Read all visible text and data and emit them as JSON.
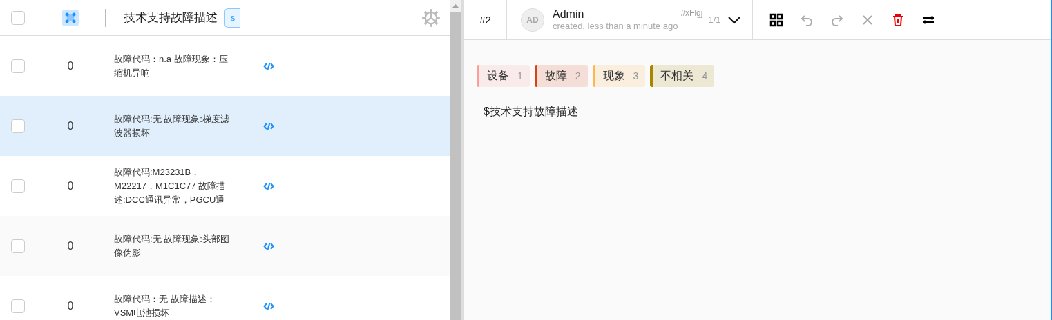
{
  "list_header": {
    "checked": false,
    "column_title": "技术支持故障描述",
    "column_chip": "s"
  },
  "rows": [
    {
      "checked": false,
      "selected": false,
      "count": "0",
      "text": "故障代码：n.a 故障现象：压缩机异响"
    },
    {
      "checked": false,
      "selected": true,
      "count": "0",
      "text": "故障代码:无 故障现象:梯度滤波器损坏"
    },
    {
      "checked": false,
      "selected": false,
      "count": "0",
      "text": "故障代码:M23231B，M22217，M1C1C77 故障描述:DCC通讯异常，PGCU通"
    },
    {
      "checked": false,
      "selected": false,
      "count": "0",
      "text": "故障代码:无 故障现象:头部图像伪影"
    },
    {
      "checked": false,
      "selected": false,
      "count": "0",
      "text": "故障代码：无 故障描述：VSM电池损坏"
    }
  ],
  "task": {
    "id": "#2",
    "avatar": "AD",
    "user": "Admin",
    "created": "created, less than a minute ago",
    "hash": "#xFlgj",
    "pager": "1/1"
  },
  "labels": [
    {
      "name": "设备",
      "hotkey": "1",
      "color": "#ff9c9c"
    },
    {
      "name": "故障",
      "hotkey": "2",
      "color": "#d84315"
    },
    {
      "name": "现象",
      "hotkey": "3",
      "color": "#ffb74d"
    },
    {
      "name": "不相关",
      "hotkey": "4",
      "color": "#a88600"
    }
  ],
  "content_text": "$技术支持故障描述"
}
